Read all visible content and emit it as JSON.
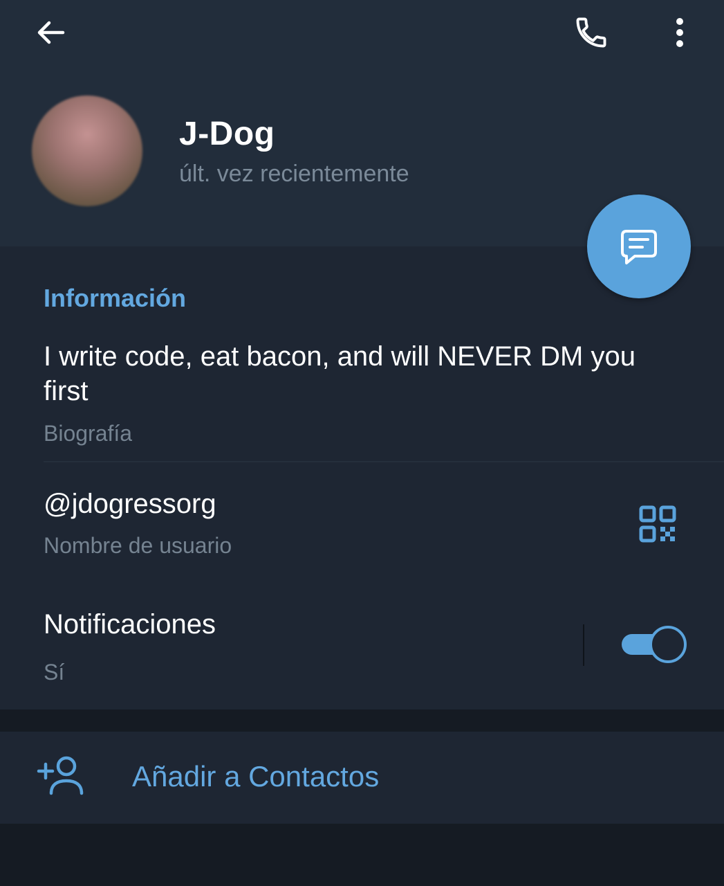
{
  "header": {
    "back_icon": "arrow-left-icon",
    "call_icon": "phone-icon",
    "more_icon": "more-vertical-icon",
    "background_color": "#222d3b"
  },
  "profile": {
    "name": "J-Dog",
    "status": "últ. vez recientemente"
  },
  "fab": {
    "icon": "message-icon",
    "color": "#5aa3dc"
  },
  "info": {
    "title": "Información",
    "bio": "I write code, eat bacon, and will NEVER DM you first",
    "bio_label": "Biografía",
    "username": "@jdogressorg",
    "username_label": "Nombre de usuario",
    "qr_icon": "qr-code-icon",
    "notifications": "Notificaciones",
    "notifications_value": "Sí",
    "notifications_enabled": true
  },
  "actions": {
    "add_contact_label": "Añadir a Contactos",
    "add_contact_icon": "add-user-icon"
  },
  "colors": {
    "accent": "#5aa3dc",
    "text_primary": "#ffffff",
    "text_secondary": "#758391",
    "section_bg": "#1e2633",
    "page_bg": "#151b23"
  }
}
